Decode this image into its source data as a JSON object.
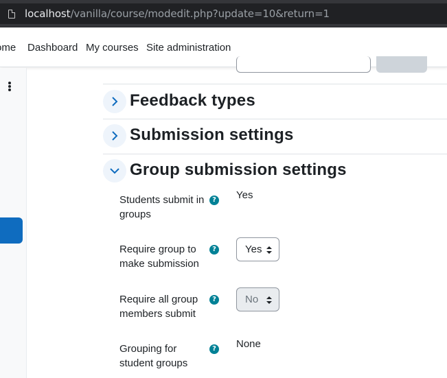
{
  "browser": {
    "url_host": "localhost",
    "url_path": "/vanilla/course/modedit.php?update=10&return=1"
  },
  "navbar": {
    "items": [
      {
        "label": "ome"
      },
      {
        "label": "Dashboard"
      },
      {
        "label": "My courses"
      },
      {
        "label": "Site administration"
      }
    ]
  },
  "sections": [
    {
      "title": "Feedback types",
      "expanded": false
    },
    {
      "title": "Submission settings",
      "expanded": false
    },
    {
      "title": "Group submission settings",
      "expanded": true
    }
  ],
  "form": {
    "students_submit_in_groups": {
      "label_line1": "Students submit in",
      "label_line2": "groups",
      "value": "Yes"
    },
    "require_group_to_make_submission": {
      "label_line1": "Require group to",
      "label_line2": "make submission",
      "value": "Yes"
    },
    "require_all_group_members_submit": {
      "label_line1": "Require all group",
      "label_line2": "members submit",
      "value": "No",
      "disabled": true
    },
    "grouping_for_student_groups": {
      "label_line1": "Grouping for",
      "label_line2": "student groups",
      "value": "None"
    }
  },
  "help_icon_glyph": "?",
  "colors": {
    "accent": "#0f6cbf",
    "help": "#008196",
    "chevron_bg": "#eef4fb"
  }
}
